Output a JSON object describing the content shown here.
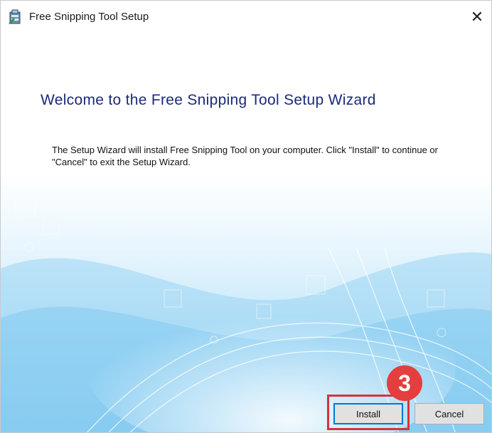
{
  "window": {
    "title": "Free Snipping Tool Setup",
    "close_glyph": "✕",
    "app_icon": "setup-installer-icon"
  },
  "wizard": {
    "heading": "Welcome to the Free Snipping Tool Setup Wizard",
    "description": "The Setup Wizard will install Free Snipping Tool on your computer.  Click \"Install\" to continue or \"Cancel\" to exit the Setup Wizard."
  },
  "buttons": {
    "install_label": "Install",
    "cancel_label": "Cancel"
  },
  "annotation": {
    "step_number": "3",
    "highlight_color": "#d9323c",
    "badge_color": "#e53e3e"
  },
  "colors": {
    "heading": "#1b2a7a",
    "accent": "#0078d7"
  }
}
